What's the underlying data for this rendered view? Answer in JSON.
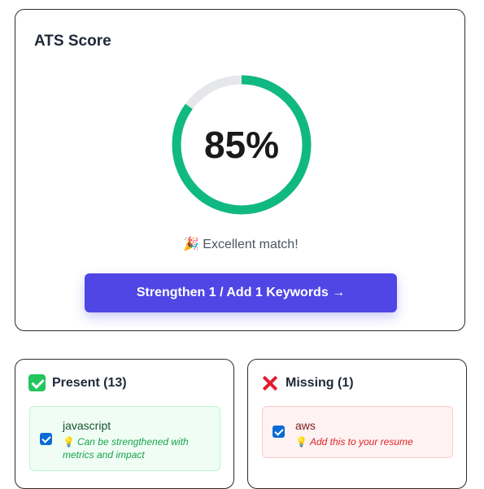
{
  "ats": {
    "title": "ATS Score",
    "score": 85,
    "score_label": "85%",
    "match_label": "Excellent match!",
    "match_emoji": "🎉",
    "cta_label": "Strengthen 1 / Add 1 Keywords →",
    "colors": {
      "ring": "#10b981",
      "ring_track": "#e5e7eb",
      "cta": "#4f46e5"
    }
  },
  "present": {
    "title": "Present (13)",
    "icon": "check-mark-icon",
    "items": [
      {
        "keyword": "javascript",
        "note": "Can be strengthened with metrics and impact",
        "checked": true
      }
    ]
  },
  "missing": {
    "title": "Missing (1)",
    "icon": "cross-mark-icon",
    "items": [
      {
        "keyword": "aws",
        "note": "Add this to your resume",
        "checked": true
      }
    ]
  },
  "bulb_icon": "💡"
}
